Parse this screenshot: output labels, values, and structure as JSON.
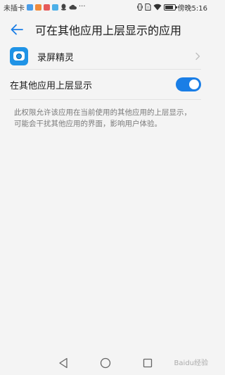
{
  "status_bar": {
    "carrier": "未插卡",
    "right_text": "傍晚5:16",
    "battery_level": 0.85,
    "app_icon_colors": [
      "#4a9de8",
      "#f08a3a",
      "#e65a5a",
      "#4cb0e8"
    ],
    "dots": "···"
  },
  "header": {
    "title": "可在其他应用上层显示的应用"
  },
  "app_row": {
    "name": "录屏精灵"
  },
  "toggle_row": {
    "label": "在其他应用上层显示",
    "enabled": true
  },
  "description": "此权限允许该应用在当前使用的其他应用的上层显示，可能会干扰其他应用的界面，影响用户体验。",
  "watermark": "Baidu经验",
  "colors": {
    "accent": "#1a7ee6",
    "app_icon": "#1f93e6"
  }
}
